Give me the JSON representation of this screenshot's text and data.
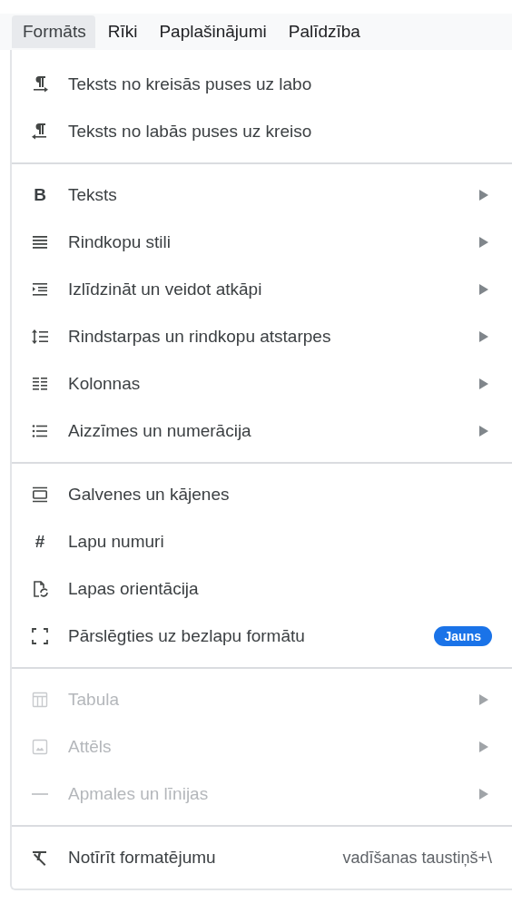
{
  "menubar": [
    {
      "label": "Formāts",
      "selected": true
    },
    {
      "label": "Rīki",
      "selected": false
    },
    {
      "label": "Paplašinājumi",
      "selected": false
    },
    {
      "label": "Palīdzība",
      "selected": false
    }
  ],
  "menu": {
    "sections": [
      {
        "items": [
          {
            "label": "Teksts no kreisās puses uz labo",
            "disabled": false,
            "submenu": false
          },
          {
            "label": "Teksts no labās puses uz kreiso",
            "disabled": false,
            "submenu": false
          }
        ]
      },
      {
        "items": [
          {
            "label": "Teksts",
            "icon_glyph": "B",
            "disabled": false,
            "submenu": true
          },
          {
            "label": "Rindkopu stili",
            "disabled": false,
            "submenu": true
          },
          {
            "label": "Izlīdzināt un veidot atkāpi",
            "disabled": false,
            "submenu": true
          },
          {
            "label": "Rindstarpas un rindkopu atstarpes",
            "disabled": false,
            "submenu": true
          },
          {
            "label": "Kolonnas",
            "disabled": false,
            "submenu": true
          },
          {
            "label": "Aizzīmes un numerācija",
            "disabled": false,
            "submenu": true
          }
        ]
      },
      {
        "items": [
          {
            "label": "Galvenes un kājenes",
            "disabled": false,
            "submenu": false
          },
          {
            "label": "Lapu numuri",
            "icon_glyph": "#",
            "disabled": false,
            "submenu": false
          },
          {
            "label": "Lapas orientācija",
            "disabled": false,
            "submenu": false
          },
          {
            "label": "Pārslēgties uz bezlapu formātu",
            "badge": "Jauns",
            "disabled": false,
            "submenu": false
          }
        ]
      },
      {
        "items": [
          {
            "label": "Tabula",
            "disabled": true,
            "submenu": true
          },
          {
            "label": "Attēls",
            "disabled": true,
            "submenu": true
          },
          {
            "label": "Apmales un līnijas",
            "disabled": true,
            "submenu": true
          }
        ]
      },
      {
        "items": [
          {
            "label": "Notīrīt formatējumu",
            "shortcut": "vadīšanas taustiņš+\\",
            "disabled": false,
            "submenu": false
          }
        ]
      }
    ]
  }
}
